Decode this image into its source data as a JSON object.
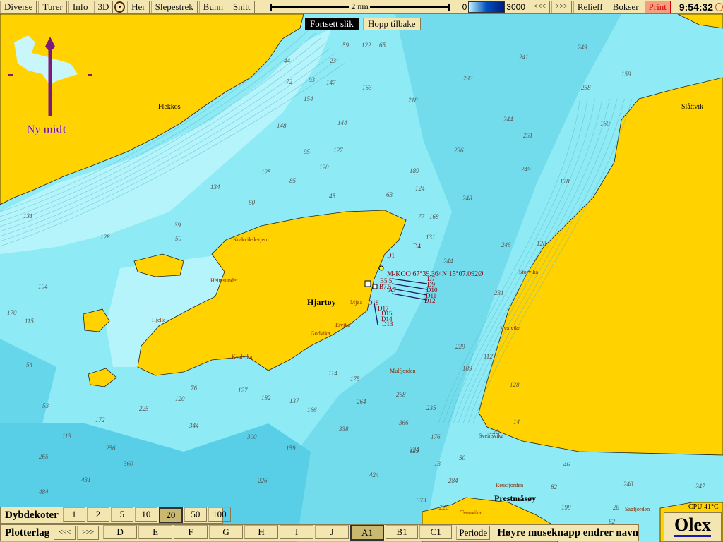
{
  "toolbar": {
    "buttons": [
      "Diverse",
      "Turer",
      "Info",
      "3D",
      "Her",
      "Slepestrek",
      "Bunn",
      "Snitt"
    ],
    "scale_label": "2 nm",
    "depth_min": "0",
    "depth_max": "3000",
    "prev": "<<<",
    "next": ">>>",
    "relief": "Relieff",
    "boxes": "Bokser",
    "print": "Print",
    "clock": "9:54:32"
  },
  "overlay": {
    "continue": "Fortsett slik",
    "jump_back": "Hopp tilbake"
  },
  "compass": {
    "label": "Ny midt"
  },
  "places": {
    "flekkos": "Flekkos",
    "slattvik": "Slåttvik",
    "hjartoy": "Hjartøy",
    "prestmasoy": "Prestmåsøy",
    "krakviksk": "Krakviksk-tjern",
    "heimsundet": "Heimsundet",
    "godvika": "Godvika",
    "eivika": "Eivika",
    "kvalvika": "Kvalvika",
    "mulfjorden": "Mulfjorden",
    "storvika": "Storvika",
    "kvalvika2": "Kvalvika",
    "sveinsvika": "Sveinsvika",
    "reusfjorden": "Reusfjorden",
    "tennvika": "Tennvika",
    "sagfjorden": "Sagfjorden",
    "hjelle": "Hjelle",
    "mjoa": "Mjøa"
  },
  "marks": {
    "position": "M-KOO 67°39.364N 15°07.092Ø",
    "labels": [
      "D4",
      "D1",
      "D7",
      "D9",
      "D10",
      "D11",
      "D12",
      "D18",
      "D17",
      "D15",
      "D14",
      "D13",
      "B5.5",
      "B7.5",
      "A7"
    ]
  },
  "depths": [
    "59",
    "122",
    "65",
    "23",
    "93",
    "241",
    "249",
    "159",
    "44",
    "72",
    "147",
    "163",
    "233",
    "258",
    "218",
    "154",
    "148",
    "144",
    "236",
    "244",
    "251",
    "160",
    "95",
    "125",
    "120",
    "127",
    "134",
    "85",
    "189",
    "249",
    "178",
    "60",
    "45",
    "63",
    "124",
    "248",
    "77",
    "168",
    "131",
    "128",
    "39",
    "50",
    "131",
    "246",
    "244",
    "128",
    "104",
    "170",
    "115",
    "54",
    "53",
    "113",
    "265",
    "484",
    "431",
    "360",
    "256",
    "172",
    "225",
    "120",
    "76",
    "127",
    "182",
    "137",
    "166",
    "114",
    "175",
    "264",
    "268",
    "338",
    "300",
    "344",
    "366",
    "235",
    "229",
    "231",
    "224",
    "189",
    "112",
    "128",
    "120",
    "14",
    "50",
    "46",
    "82",
    "240",
    "247",
    "159",
    "226",
    "424",
    "373",
    "226",
    "198",
    "28",
    "62",
    "13",
    "176",
    "129",
    "284",
    "229"
  ],
  "depth_contours": {
    "label": "Dybdekoter",
    "values": [
      "1",
      "2",
      "5",
      "10",
      "20",
      "50",
      "100"
    ],
    "selected": "20"
  },
  "plot_layers": {
    "label": "Plotterlag",
    "prev": "<<<",
    "next": ">>>",
    "layers": [
      "D",
      "E",
      "F",
      "G",
      "H",
      "I",
      "J",
      "A1",
      "B1",
      "C1"
    ],
    "selected": "A1",
    "period": "Periode",
    "hint": "Høyre museknapp endrer navn"
  },
  "cpu": "CPU 41°C",
  "logo": "Olex",
  "colors": {
    "land": "#ffd200",
    "shallow": "#b4f4fa",
    "water": "#8eeaf4",
    "deep": "#58cfe6",
    "toolbar": "#f4e6b0",
    "compass": "#7a1a7a"
  }
}
